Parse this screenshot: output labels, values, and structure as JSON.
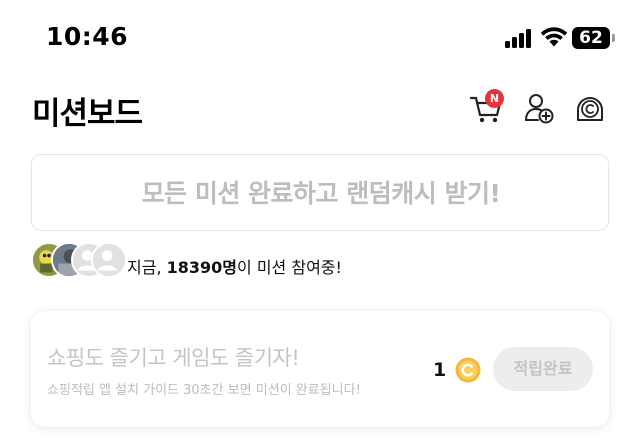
{
  "status_bar": {
    "time": "10:46",
    "battery_level": "62"
  },
  "header": {
    "title": "미션보드",
    "cart_badge": "N",
    "icons": [
      "cart-icon",
      "add-user-icon",
      "coin-history-icon"
    ]
  },
  "banner": {
    "text": "모든 미션 완료하고 랜덤캐시 받기!"
  },
  "participants": {
    "prefix": "지금, ",
    "count": "18390명",
    "suffix": "이 미션 참여중!"
  },
  "mission": {
    "title": "쇼핑도 즐기고 게임도 즐기자!",
    "description": "쇼핑적립 앱 설치 가이드 30초간 보면 미션이 완료됩니다!",
    "reward": "1",
    "button_label": "적립완료"
  },
  "colors": {
    "badge": "#e8323b",
    "coin": "#f4b93a",
    "muted_text": "#bdbdbd"
  }
}
